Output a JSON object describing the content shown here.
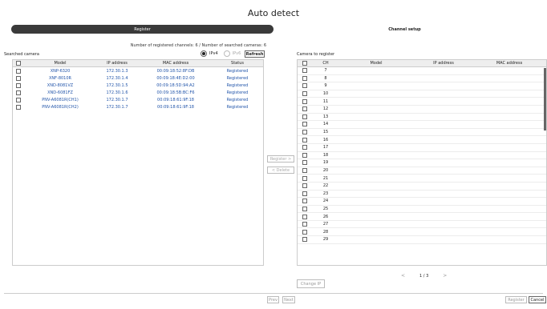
{
  "title": "Auto detect",
  "tabs": [
    {
      "label": "Register",
      "active": true
    },
    {
      "label": "Channel setup",
      "active": false
    }
  ],
  "summary": "Number of registered channels: 6 / Number of searched cameras: 6",
  "searched": {
    "label": "Searched camera",
    "ip_options": [
      {
        "label": "IPv4",
        "selected": true
      },
      {
        "label": "IPv6",
        "selected": false
      }
    ],
    "refresh_label": "Refresh",
    "columns": [
      "Model",
      "IP address",
      "MAC address",
      "Status"
    ],
    "rows": [
      {
        "model": "XNP-6320",
        "ip": "172.30.1.3",
        "mac": "00:09:18:52:8F:DB",
        "status": "Registered"
      },
      {
        "model": "XNF-8010R",
        "ip": "172.30.1.4",
        "mac": "00:09:18:4E:D2:00",
        "status": "Registered"
      },
      {
        "model": "XND-8081VZ",
        "ip": "172.30.1.5",
        "mac": "00:09:18:5D:94:A2",
        "status": "Registered"
      },
      {
        "model": "XND-6081FZ",
        "ip": "172.30.1.6",
        "mac": "00:09:18:5B:BC:F6",
        "status": "Registered"
      },
      {
        "model": "PNV-A6081R(CH1)",
        "ip": "172.30.1.7",
        "mac": "00:09:18:61:9F:18",
        "status": "Registered"
      },
      {
        "model": "PNV-A6081R(CH2)",
        "ip": "172.30.1.7",
        "mac": "00:09:18:61:9F:18",
        "status": "Registered"
      }
    ]
  },
  "middle": {
    "register_label": "Register >",
    "delete_label": "< Delete"
  },
  "register_table": {
    "label": "Camera to register",
    "columns": [
      "CH",
      "Model",
      "IP address",
      "MAC address"
    ],
    "channels": [
      "7",
      "8",
      "9",
      "10",
      "11",
      "12",
      "13",
      "14",
      "15",
      "16",
      "17",
      "18",
      "19",
      "20",
      "21",
      "22",
      "23",
      "24",
      "25",
      "26",
      "27",
      "28",
      "29"
    ]
  },
  "pager": {
    "prev": "<",
    "text": "1 / 3",
    "next": ">"
  },
  "change_ip_label": "Change IP",
  "footer": {
    "prev_label": "Prev",
    "next_label": "Next",
    "register_label": "Register",
    "cancel_label": "Cancel"
  }
}
